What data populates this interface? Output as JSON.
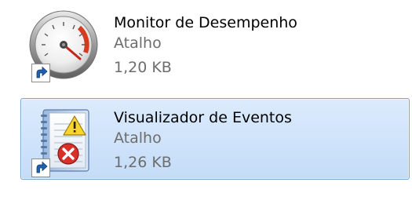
{
  "files": [
    {
      "name": "Monitor de Desempenho",
      "type": "Atalho",
      "size": "1,20 KB",
      "icon": "performance-monitor-gauge-icon",
      "selected": false
    },
    {
      "name": "Visualizador de Eventos",
      "type": "Atalho",
      "size": "1,26 KB",
      "icon": "event-viewer-log-icon",
      "selected": true
    }
  ],
  "colors": {
    "selection_bg": "#cce1f9",
    "selection_border": "#7da2ce",
    "secondary_text": "#6d6d6d"
  }
}
